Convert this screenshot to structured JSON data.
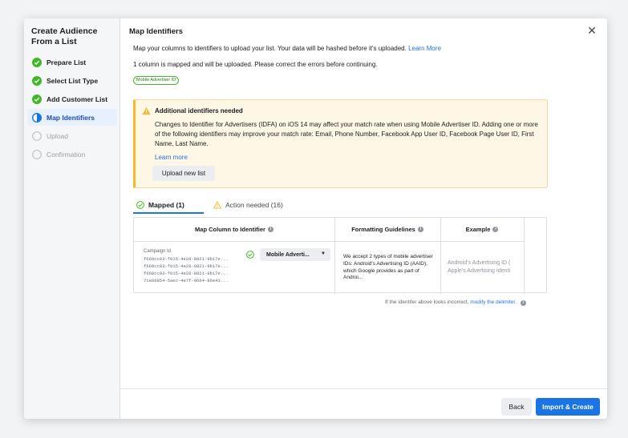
{
  "sidebar": {
    "title": "Create Audience From a List",
    "steps": [
      {
        "label": "Prepare List",
        "state": "done"
      },
      {
        "label": "Select List Type",
        "state": "done"
      },
      {
        "label": "Add Customer List",
        "state": "done"
      },
      {
        "label": "Map Identifiers",
        "state": "active"
      },
      {
        "label": "Upload",
        "state": "pending"
      },
      {
        "label": "Confirmation",
        "state": "pending"
      }
    ]
  },
  "header": {
    "title": "Map Identifiers",
    "close_icon": "close-icon",
    "description": "Map your columns to identifiers to upload your list. Your data will be hashed before it's uploaded.",
    "learn_more": "Learn More",
    "mapped_status": "1 column is mapped and will be uploaded. Please correct the errors before continuing.",
    "chip": "Mobile Advertiser ID"
  },
  "alert": {
    "title": "Additional identifiers needed",
    "body": "Changes to Identifier for Advertisers (IDFA) on iOS 14 may affect your match rate when using Mobile Advertiser ID. Adding one or more of the following identifiers may improve your match rate: Email, Phone Number, Facebook App User ID, Facebook Page User ID, First Name, Last Name.",
    "learn_more": "Learn more",
    "button": "Upload new list"
  },
  "tabs": [
    {
      "label": "Mapped (1)",
      "active": true
    },
    {
      "label": "Action needed (16)",
      "active": false
    }
  ],
  "table": {
    "headers": [
      "Map Column to Identifier",
      "Formatting Guidelines",
      "Example"
    ],
    "row": {
      "column_name": "Campaign Id",
      "samples": [
        "f660cc03-f015-4e20-8821-9b17e...",
        "f660cc03-f015-4e20-8821-9b17e...",
        "f660cc03-f015-4e20-8821-9b17e...",
        "71e86854-5aec-4e7f-9664-86e43..."
      ],
      "identifier": "Mobile Adverti...",
      "guidelines": "We accept 2 types of mobile advertiser IDs: Android's Advertising ID (AAID), which Google provides as part of Androi...",
      "examples": [
        "Android's Advertising ID (",
        "Apple's Advertising Identi"
      ]
    }
  },
  "delimiter": {
    "text": "If the identifer above looks incorrect,",
    "link": "modify the delimiter."
  },
  "footer": {
    "back": "Back",
    "primary": "Import & Create"
  },
  "colors": {
    "primary": "#1b74e4",
    "success": "#42b72a",
    "warning": "#f7b928"
  }
}
